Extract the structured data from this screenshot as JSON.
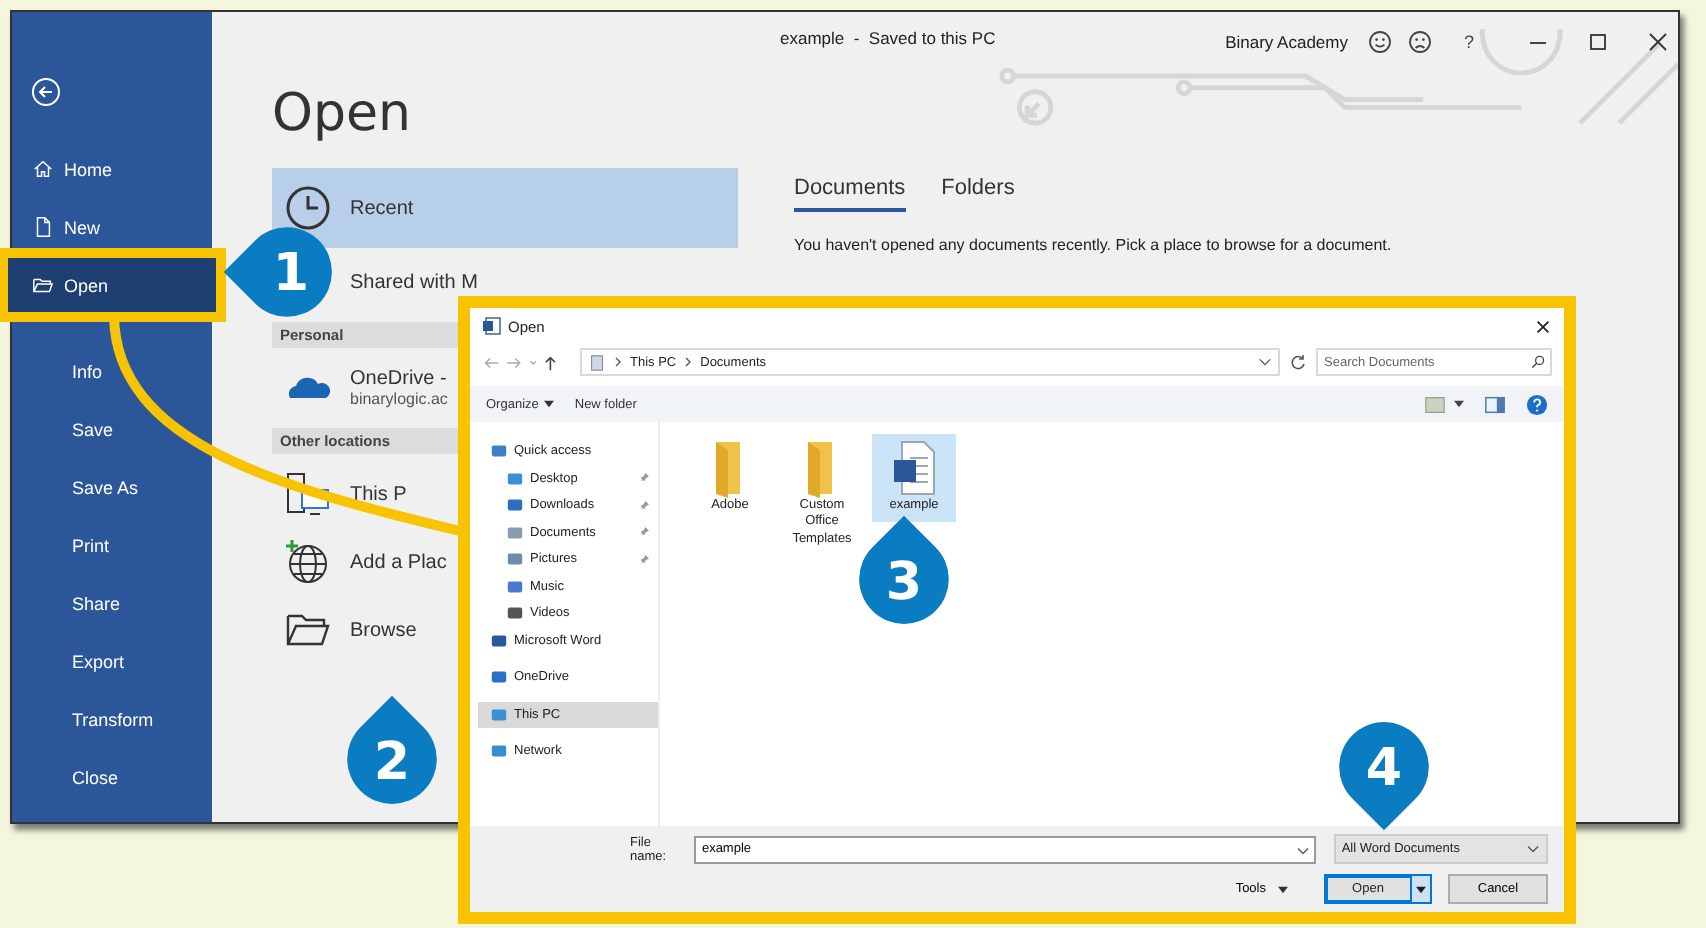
{
  "window": {
    "title": "example  -  Saved to this PC",
    "account": "Binary Academy",
    "help": "?"
  },
  "sidebar": {
    "items": [
      {
        "label": "Home",
        "selected": false
      },
      {
        "label": "New",
        "selected": false
      },
      {
        "label": "Open",
        "selected": true
      }
    ],
    "more_items": [
      {
        "label": "Info",
        "selected": false
      },
      {
        "label": "Save",
        "selected": false
      },
      {
        "label": "Save As",
        "selected": false
      },
      {
        "label": "Print",
        "selected": false
      },
      {
        "label": "Share",
        "selected": false
      },
      {
        "label": "Export",
        "selected": false
      },
      {
        "label": "Transform",
        "selected": false
      },
      {
        "label": "Close",
        "selected": false
      }
    ]
  },
  "page_title": "Open",
  "locations": [
    {
      "kind": "item",
      "label": "Recent",
      "selected": true
    },
    {
      "kind": "item",
      "label": "Shared with M",
      "selected": false
    },
    {
      "kind": "header",
      "label": "Personal"
    },
    {
      "kind": "item",
      "label": "OneDrive -",
      "sublabel": "binarylogic.ac",
      "selected": false
    },
    {
      "kind": "header",
      "label": "Other locations"
    },
    {
      "kind": "item",
      "label": "This P",
      "selected": false
    },
    {
      "kind": "item",
      "label": "Add a Plac",
      "selected": false
    },
    {
      "kind": "item",
      "label": "Browse",
      "selected": false
    }
  ],
  "tabs": [
    {
      "label": "Documents",
      "selected": true
    },
    {
      "label": "Folders",
      "selected": false
    }
  ],
  "message": "You haven't opened any documents recently. Pick a place to browse for a document.",
  "dialog": {
    "title": "Open",
    "path": [
      "This PC",
      "Documents"
    ],
    "search": {
      "placeholder": "Search Documents"
    },
    "organize": "Organize",
    "new_folder": "New folder",
    "nav": [
      {
        "label": "Quick access",
        "selected": false,
        "children": [
          {
            "label": "Desktop",
            "pinned": true,
            "selected": false
          },
          {
            "label": "Downloads",
            "pinned": true,
            "selected": false
          },
          {
            "label": "Documents",
            "pinned": true,
            "selected": false
          },
          {
            "label": "Pictures",
            "pinned": true,
            "selected": false
          },
          {
            "label": "Music",
            "pinned": false,
            "selected": false
          },
          {
            "label": "Videos",
            "pinned": false,
            "selected": false
          }
        ]
      },
      {
        "label": "Microsoft Word",
        "selected": false
      },
      {
        "label": "OneDrive",
        "selected": false
      },
      {
        "label": "This PC",
        "selected": true
      },
      {
        "label": "Network",
        "selected": false
      }
    ],
    "files": [
      {
        "kind": "folder",
        "label": "Adobe",
        "selected": false
      },
      {
        "kind": "folder",
        "label": "Custom Office Templates",
        "selected": false
      },
      {
        "kind": "document",
        "label": "example",
        "selected": true
      }
    ],
    "file_name": {
      "label": "File name:",
      "value": "example"
    },
    "file_type": {
      "value": "All Word Documents"
    },
    "tools": "Tools",
    "buttons": [
      {
        "label": "Open",
        "kind": "split",
        "default": true
      },
      {
        "label": "Cancel",
        "kind": "plain",
        "default": false
      }
    ]
  },
  "callouts": [
    {
      "label": "1"
    },
    {
      "label": "2"
    },
    {
      "label": "3"
    },
    {
      "label": "4"
    }
  ]
}
